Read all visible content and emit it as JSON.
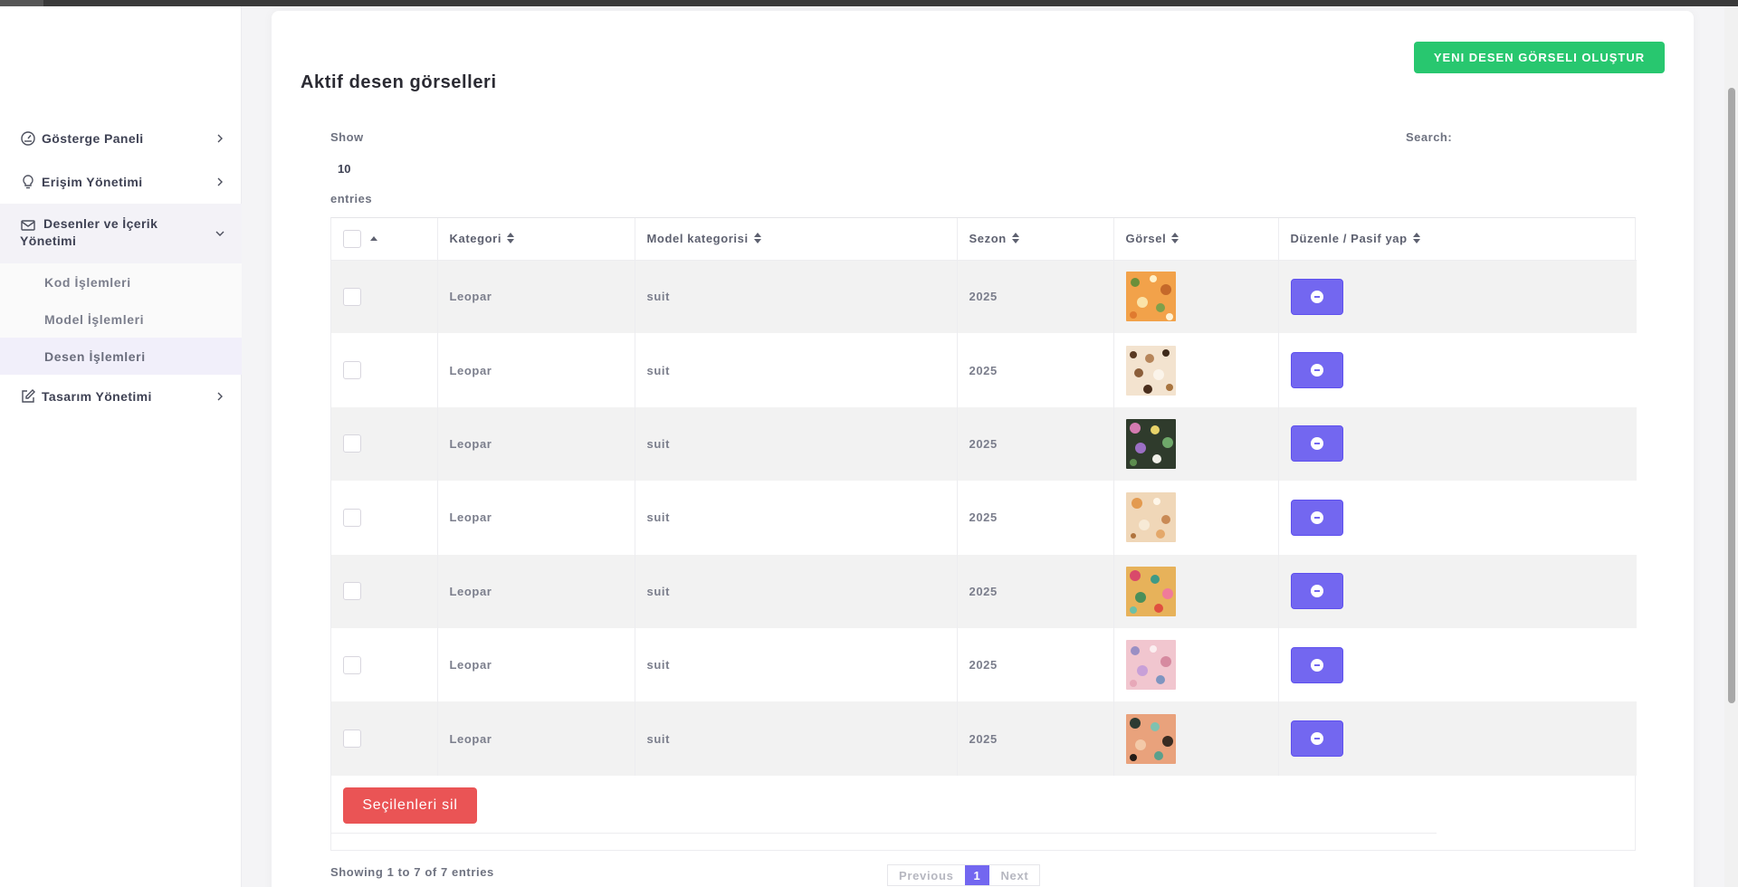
{
  "sidebar": {
    "items": [
      {
        "label": "Gösterge Paneli",
        "icon": "gauge-icon"
      },
      {
        "label": "Erişim Yönetimi",
        "icon": "lightbulb-icon"
      },
      {
        "label": "Desenler ve İçerik Yönetimi",
        "icon": "mail-icon"
      },
      {
        "label": "Tasarım Yönetimi",
        "icon": "edit-icon"
      }
    ],
    "submenu": [
      {
        "label": "Kod İşlemleri"
      },
      {
        "label": "Model İşlemleri"
      },
      {
        "label": "Desen İşlemleri",
        "active": true
      }
    ]
  },
  "page": {
    "title": "Aktif desen görselleri",
    "new_button": "YENI DESEN GÖRSELI OLUŞTUR"
  },
  "datatable": {
    "show_label": "Show",
    "length_value": "10",
    "entries_label": "entries",
    "search_label": "Search:",
    "columns": [
      "Kategori",
      "Model kategorisi",
      "Sezon",
      "Görsel",
      "Düzenle / Pasif yap"
    ],
    "rows": [
      {
        "kategori": "Leopar",
        "model": "suit",
        "sezon": "2025"
      },
      {
        "kategori": "Leopar",
        "model": "suit",
        "sezon": "2025"
      },
      {
        "kategori": "Leopar",
        "model": "suit",
        "sezon": "2025"
      },
      {
        "kategori": "Leopar",
        "model": "suit",
        "sezon": "2025"
      },
      {
        "kategori": "Leopar",
        "model": "suit",
        "sezon": "2025"
      },
      {
        "kategori": "Leopar",
        "model": "suit",
        "sezon": "2025"
      },
      {
        "kategori": "Leopar",
        "model": "suit",
        "sezon": "2025"
      }
    ],
    "delete_selected": "Seçilenleri sil",
    "info": "Showing 1 to 7 of 7 entries",
    "pagination": {
      "previous": "Previous",
      "current": "1",
      "next": "Next"
    }
  },
  "colors": {
    "accent": "#7367f0",
    "success": "#28c76f",
    "danger": "#ea5455"
  }
}
